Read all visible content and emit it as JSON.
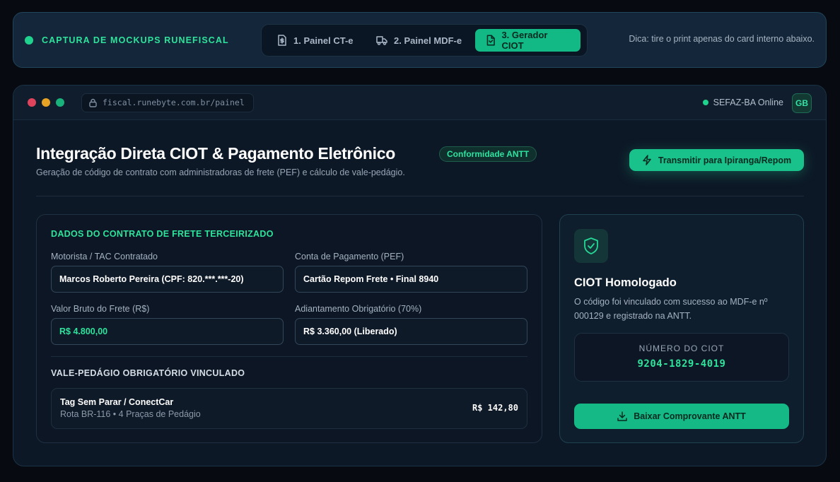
{
  "capture": {
    "title": "CAPTURA DE MOCKUPS RUNEFISCAL",
    "hint": "Dica: tire o print apenas do card interno abaixo.",
    "tabs": [
      {
        "label": "1. Painel CT-e",
        "icon": "document-dollar-icon",
        "active": false
      },
      {
        "label": "2. Painel MDF-e",
        "icon": "truck-icon",
        "active": false
      },
      {
        "label": "3. Gerador CIOT",
        "icon": "file-icon",
        "active": true
      }
    ]
  },
  "window": {
    "url": "fiscal.runebyte.com.br/painel",
    "status": "SEFAZ-BA Online",
    "avatar": "GB"
  },
  "page": {
    "title": "Integração Direta CIOT & Pagamento Eletrônico",
    "badge": "Conformidade ANTT",
    "subtitle": "Geração de código de contrato com administradoras de frete (PEF) e cálculo de vale-pedágio.",
    "transmit_label": "Transmitir para Ipiranga/Repom"
  },
  "contract": {
    "section_title": "DADOS DO CONTRATO DE FRETE TERCEIRIZADO",
    "fields": {
      "driver": {
        "label": "Motorista / TAC Contratado",
        "value": "Marcos Roberto Pereira (CPF: 820.***.***-20)"
      },
      "payment_account": {
        "label": "Conta de Pagamento (PEF)",
        "value": "Cartão Repom Frete • Final 8940"
      },
      "gross_value": {
        "label": "Valor Bruto do Frete (R$)",
        "value": "R$ 4.800,00"
      },
      "advance": {
        "label": "Adiantamento Obrigatório (70%)",
        "value": "R$ 3.360,00 (Liberado)"
      }
    },
    "toll_section_title": "VALE-PEDÁGIO OBRIGATÓRIO VINCULADO",
    "toll": {
      "name": "Tag Sem Parar / ConectCar",
      "route": "Rota BR-116 • 4 Praças de Pedágio",
      "value": "R$ 142,80"
    }
  },
  "ciot": {
    "icon": "shield-check-icon",
    "title": "CIOT Homologado",
    "description": "O código foi vinculado com sucesso ao MDF-e nº 000129 e registrado na ANTT.",
    "number_label": "NÚMERO DO CIOT",
    "number": "9204-1829-4019",
    "download_label": "Baixar Comprovante ANTT"
  },
  "colors": {
    "accent": "#19c28b",
    "accent_text": "#2ee39b",
    "background": "#070b11",
    "card": "#0d1826"
  }
}
